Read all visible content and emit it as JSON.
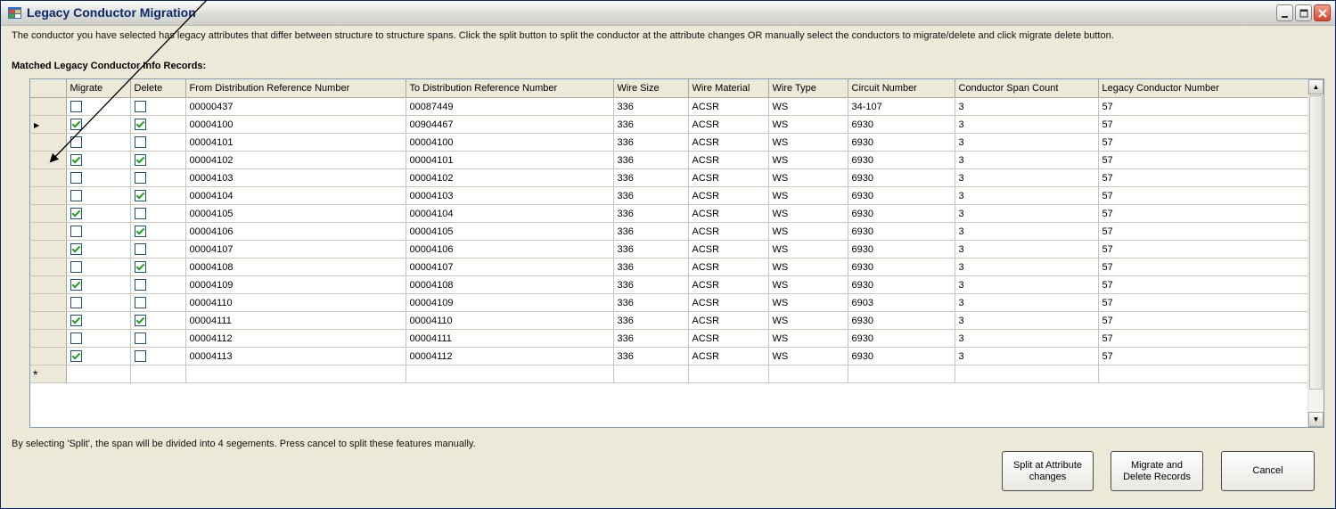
{
  "window": {
    "title": "Legacy Conductor Migration",
    "controls": [
      "minimize",
      "maximize",
      "close"
    ]
  },
  "description": "The conductor you have selected has legacy attributes that differ between structure to structure spans. Click the split button to split the conductor at the attribute changes OR manually select the conductors to migrate/delete and click migrate delete button.",
  "section_title": "Matched Legacy Conductor Info Records:",
  "grid": {
    "columns": [
      "Migrate",
      "Delete",
      "From Distribution Reference Number",
      "To Distribution Reference Number",
      "Wire Size",
      "Wire Material",
      "Wire Type",
      "Circuit Number",
      "Conductor Span Count",
      "Legacy Conductor Number"
    ],
    "current_row_index": 1,
    "new_row_marker": "*",
    "rows": [
      {
        "migrate": false,
        "delete": false,
        "from": "00000437",
        "to": "00087449",
        "wire_size": "336",
        "wire_material": "ACSR",
        "wire_type": "WS",
        "circuit": "34-107",
        "span_count": "3",
        "legacy": "57"
      },
      {
        "migrate": true,
        "delete": true,
        "from": "00004100",
        "to": "00904467",
        "wire_size": "336",
        "wire_material": "ACSR",
        "wire_type": "WS",
        "circuit": "6930",
        "span_count": "3",
        "legacy": "57"
      },
      {
        "migrate": false,
        "delete": false,
        "from": "00004101",
        "to": "00004100",
        "wire_size": "336",
        "wire_material": "ACSR",
        "wire_type": "WS",
        "circuit": "6930",
        "span_count": "3",
        "legacy": "57"
      },
      {
        "migrate": true,
        "delete": true,
        "from": "00004102",
        "to": "00004101",
        "wire_size": "336",
        "wire_material": "ACSR",
        "wire_type": "WS",
        "circuit": "6930",
        "span_count": "3",
        "legacy": "57"
      },
      {
        "migrate": false,
        "delete": false,
        "from": "00004103",
        "to": "00004102",
        "wire_size": "336",
        "wire_material": "ACSR",
        "wire_type": "WS",
        "circuit": "6930",
        "span_count": "3",
        "legacy": "57"
      },
      {
        "migrate": false,
        "delete": true,
        "from": "00004104",
        "to": "00004103",
        "wire_size": "336",
        "wire_material": "ACSR",
        "wire_type": "WS",
        "circuit": "6930",
        "span_count": "3",
        "legacy": "57"
      },
      {
        "migrate": true,
        "delete": false,
        "from": "00004105",
        "to": "00004104",
        "wire_size": "336",
        "wire_material": "ACSR",
        "wire_type": "WS",
        "circuit": "6930",
        "span_count": "3",
        "legacy": "57"
      },
      {
        "migrate": false,
        "delete": true,
        "from": "00004106",
        "to": "00004105",
        "wire_size": "336",
        "wire_material": "ACSR",
        "wire_type": "WS",
        "circuit": "6930",
        "span_count": "3",
        "legacy": "57"
      },
      {
        "migrate": true,
        "delete": false,
        "from": "00004107",
        "to": "00004106",
        "wire_size": "336",
        "wire_material": "ACSR",
        "wire_type": "WS",
        "circuit": "6930",
        "span_count": "3",
        "legacy": "57"
      },
      {
        "migrate": false,
        "delete": true,
        "from": "00004108",
        "to": "00004107",
        "wire_size": "336",
        "wire_material": "ACSR",
        "wire_type": "WS",
        "circuit": "6930",
        "span_count": "3",
        "legacy": "57"
      },
      {
        "migrate": true,
        "delete": false,
        "from": "00004109",
        "to": "00004108",
        "wire_size": "336",
        "wire_material": "ACSR",
        "wire_type": "WS",
        "circuit": "6930",
        "span_count": "3",
        "legacy": "57"
      },
      {
        "migrate": false,
        "delete": false,
        "from": "00004110",
        "to": "00004109",
        "wire_size": "336",
        "wire_material": "ACSR",
        "wire_type": "WS",
        "circuit": "6903",
        "span_count": "3",
        "legacy": "57"
      },
      {
        "migrate": true,
        "delete": true,
        "from": "00004111",
        "to": "00004110",
        "wire_size": "336",
        "wire_material": "ACSR",
        "wire_type": "WS",
        "circuit": "6930",
        "span_count": "3",
        "legacy": "57"
      },
      {
        "migrate": false,
        "delete": false,
        "from": "00004112",
        "to": "00004111",
        "wire_size": "336",
        "wire_material": "ACSR",
        "wire_type": "WS",
        "circuit": "6930",
        "span_count": "3",
        "legacy": "57"
      },
      {
        "migrate": true,
        "delete": false,
        "from": "00004113",
        "to": "00004112",
        "wire_size": "336",
        "wire_material": "ACSR",
        "wire_type": "WS",
        "circuit": "6930",
        "span_count": "3",
        "legacy": "57"
      }
    ]
  },
  "status_text": "By selecting 'Split', the span will be divided into 4 segements.  Press cancel to split these features manually.",
  "buttons": {
    "split": "Split at Attribute changes",
    "migrate_delete": "Migrate and Delete Records",
    "cancel": "Cancel"
  },
  "icons": {
    "window": "app-window-icon",
    "current_row": "row-pointer-icon",
    "scroll_up": "scroll-up-icon",
    "scroll_down": "scroll-down-icon"
  }
}
